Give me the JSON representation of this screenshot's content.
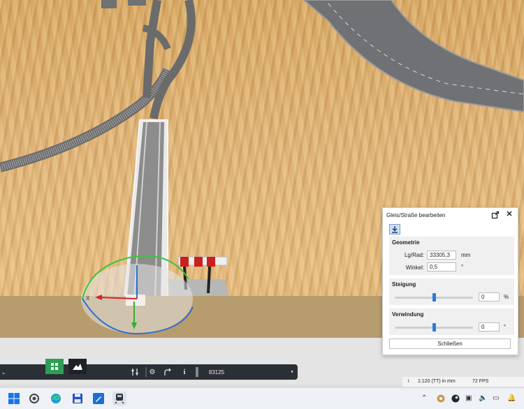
{
  "panel": {
    "title": "Gleis/Straße bearbeiten",
    "geometrie": {
      "title": "Geometrie",
      "length_label": "Lg/Rad:",
      "length_value": "33305,3",
      "length_unit": "mm",
      "angle_label": "Winkel:",
      "angle_value": "0,5",
      "angle_unit": "°"
    },
    "steigung": {
      "title": "Steigung",
      "value": "0",
      "unit": "%",
      "slider_fraction": 0.5
    },
    "verwindung": {
      "title": "Verwindung",
      "value": "0",
      "unit": "°",
      "slider_fraction": 0.5
    },
    "close_label": "Schließen"
  },
  "toolbar": {
    "counter": "83125"
  },
  "statusbar": {
    "info_icon": "i",
    "scale": "1:120 (TT) in mm",
    "fps": "72 FPS"
  },
  "gizmo": {
    "x_label": "X"
  },
  "colors": {
    "accent_blue": "#2e7bd6",
    "toolbar_bg": "#2b2f36",
    "active_green": "#2f9e55",
    "terrain": "#e3b578"
  },
  "taskbar": {
    "icons": [
      "windows-start-icon",
      "cortana-icon",
      "edge-icon",
      "save-icon",
      "editor-icon",
      "train-simulator-icon"
    ]
  }
}
